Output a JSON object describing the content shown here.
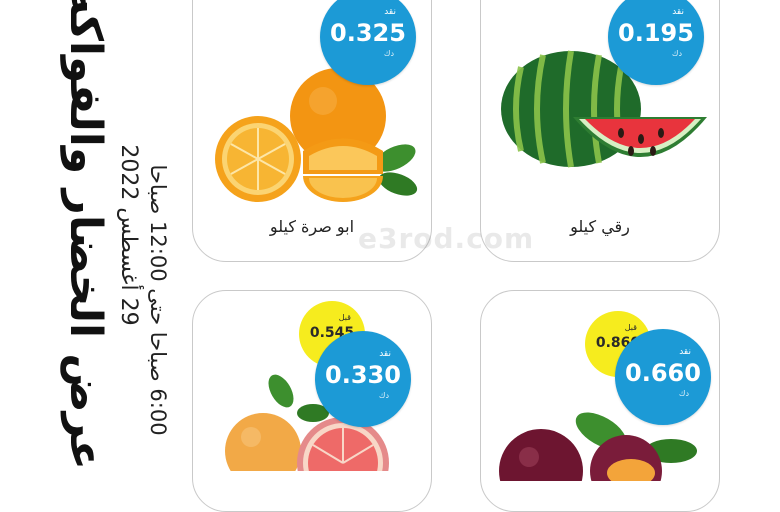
{
  "promo": {
    "title": "عرض الخضار والفواكه",
    "date": "29 أغسطس 2022",
    "time": "6:00 صباحا حتى 12:00 صباحا"
  },
  "watermark": "e3rod.com",
  "products": [
    {
      "name": "ابو صرة كيلو",
      "price_tag": "نقد",
      "price": "0.325",
      "currency": "دك",
      "icon": "orange-icon"
    },
    {
      "name": "رقي كيلو",
      "price_tag": "نقد",
      "price": "0.195",
      "currency": "دك",
      "icon": "watermelon-icon"
    },
    {
      "name": "",
      "price_tag": "نقد",
      "price": "0.330",
      "currency": "دك",
      "old_price_tag": "قبل",
      "old_price": "0.545",
      "old_currency": "دك",
      "icon": "grapefruit-icon"
    },
    {
      "name": "",
      "price_tag": "نقد",
      "price": "0.660",
      "currency": "دك",
      "old_price_tag": "قبل",
      "old_price": "0.860",
      "old_currency": "دك",
      "icon": "plum-icon"
    }
  ],
  "colors": {
    "price_badge": "#1c9ad6",
    "old_price_badge": "#f6ec1e",
    "card_border": "#c9c9c9"
  }
}
